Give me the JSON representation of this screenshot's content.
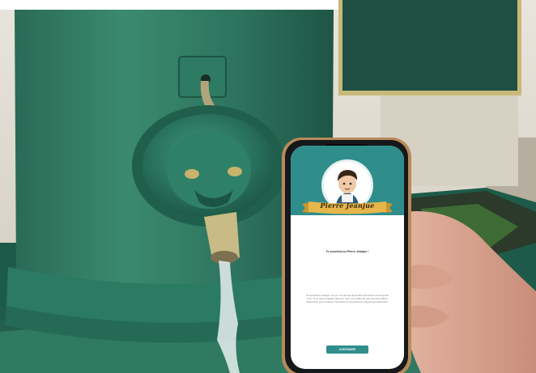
{
  "app": {
    "character_name": "Pierre Jeanjue",
    "welcome_text": "Te souviens-tu Pierre Jeanjue !",
    "body_text": "Je suis Pierre Jeanjue. Ce jeu me permet aujourd'hui de revenir au temps de Lyon. Si tu vas te balader dans les rues, il te suffira de retrouver les indices disséminés pour continuer l'aventure et résoudre les énigmes qui t'attendent.",
    "continue_label": "CONTINUER"
  },
  "colors": {
    "app_teal": "#2f8e8c",
    "ribbon_gold": "#e6b64a",
    "fountain_green": "#2a6e58",
    "plaque_green": "#1f4f43"
  }
}
